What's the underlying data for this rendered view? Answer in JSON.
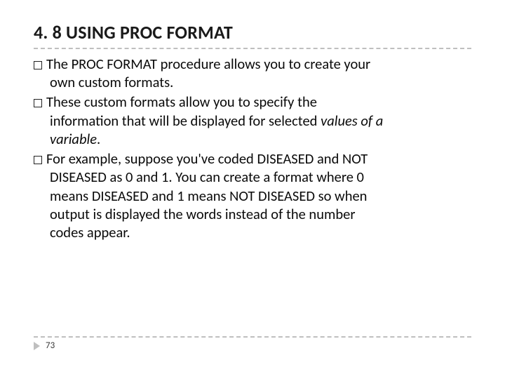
{
  "slide": {
    "title": "4. 8 USING PROC FORMAT",
    "bullets": [
      {
        "lead": "The PROC FORMAT procedure allows you to create your",
        "cont": [
          "own custom formats."
        ]
      },
      {
        "lead": "These custom formats allow you to specify the",
        "cont": [
          "information that will be displayed for selected "
        ],
        "italic_tail": "values of a",
        "cont2": [
          "variable"
        ],
        "tail_after_italic": "."
      },
      {
        "lead": "For example, suppose you've coded DISEASED and NOT",
        "cont": [
          "DISEASED as 0 and 1. You can create a format where 0",
          "means DISEASED and 1 means NOT DISEASED so when",
          "output is displayed the words instead of the number",
          "codes appear."
        ]
      }
    ],
    "page_number": "73"
  }
}
